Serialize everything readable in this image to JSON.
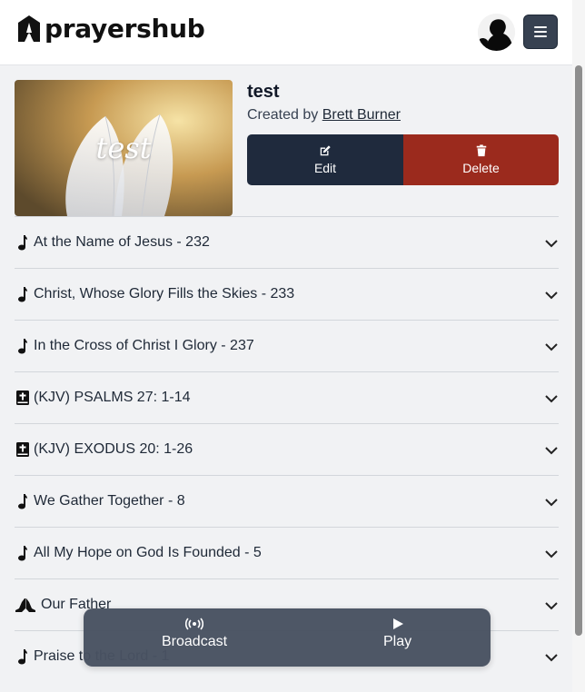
{
  "app": {
    "brand": "prayershub"
  },
  "header": {
    "menu_icon": "bars-icon",
    "avatar_icon": "user-avatar"
  },
  "playlist": {
    "cover_text": "test",
    "title": "test",
    "created_by_prefix": "Created by",
    "author": "Brett Burner",
    "edit_label": "Edit",
    "delete_label": "Delete"
  },
  "items": [
    {
      "icon": "music-note-icon",
      "label": "At the Name of Jesus - 232"
    },
    {
      "icon": "music-note-icon",
      "label": "Christ, Whose Glory Fills the Skies - 233"
    },
    {
      "icon": "music-note-icon",
      "label": "In the Cross of Christ I Glory - 237"
    },
    {
      "icon": "bible-icon",
      "label": "(KJV) PSALMS 27: 1-14"
    },
    {
      "icon": "bible-icon",
      "label": "(KJV) EXODUS 20: 1-26"
    },
    {
      "icon": "music-note-icon",
      "label": "We Gather Together - 8"
    },
    {
      "icon": "music-note-icon",
      "label": "All My Hope on God Is Founded - 5"
    },
    {
      "icon": "praying-hands-icon",
      "label": "Our Father"
    },
    {
      "icon": "music-note-icon",
      "label": "Praise to the Lord - 1"
    }
  ],
  "player": {
    "broadcast_label": "Broadcast",
    "play_label": "Play"
  },
  "colors": {
    "edit": "#1f2a3d",
    "delete": "#9b2a1d",
    "player": "#495262"
  }
}
